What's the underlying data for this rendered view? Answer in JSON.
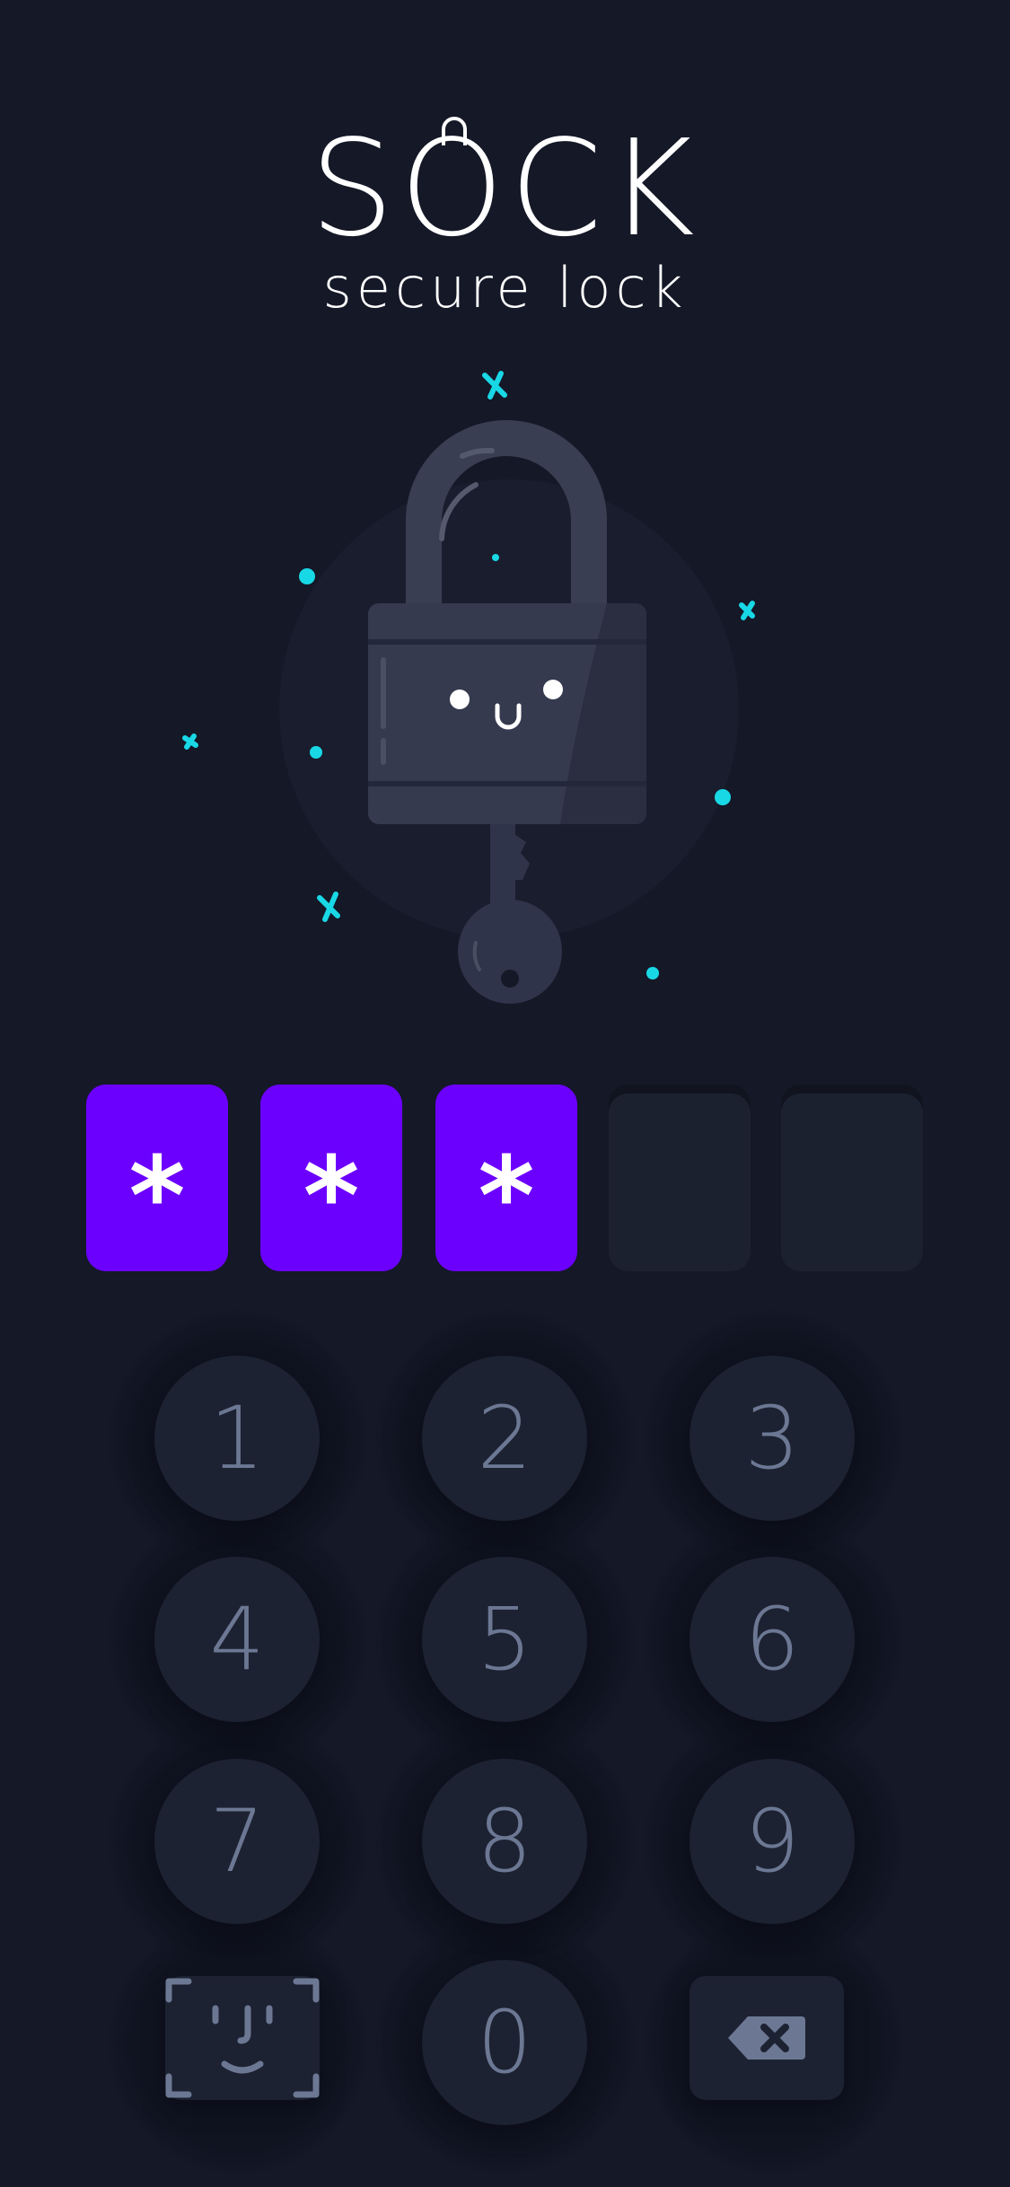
{
  "brand": {
    "title_before_o": "S",
    "title_o": "O",
    "title_after_o": "CK",
    "subtitle": "secure lock"
  },
  "pin": {
    "length": 5,
    "entered": 3,
    "mask_char": "*",
    "filled_color": "#6c00ff",
    "empty_color": "#1c2130"
  },
  "keypad": {
    "keys": [
      "1",
      "2",
      "3",
      "4",
      "5",
      "6",
      "7",
      "8",
      "9",
      "0"
    ],
    "face_id_icon": "face-id-icon",
    "delete_icon": "backspace-icon"
  },
  "colors": {
    "background": "#141827",
    "accent": "#6c00ff",
    "sparkle": "#19d8e6",
    "key_text": "#6c7893"
  }
}
